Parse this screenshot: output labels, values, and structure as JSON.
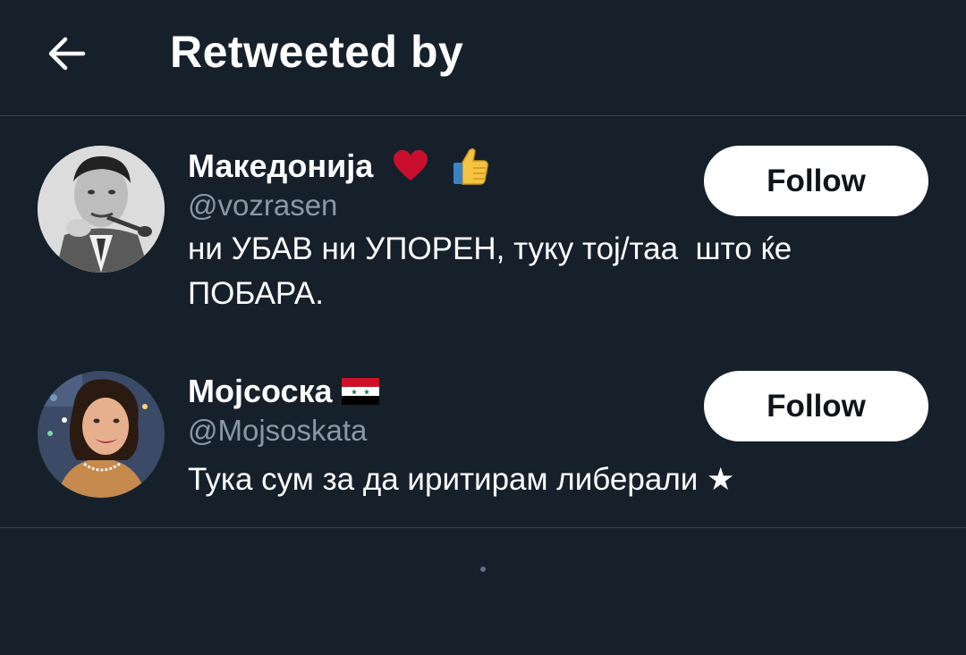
{
  "header": {
    "title": "Retweeted by",
    "back_icon": "arrow-left-icon"
  },
  "users": [
    {
      "display_name": "Македонија",
      "emojis": [
        "heart-icon",
        "thumbs-up-icon"
      ],
      "handle": "@vozrasen",
      "bio_line1": "ни УБАВ ни УПОРЕН, туку тој/таа  што ќе",
      "bio_line2": "ПОБАРА.",
      "follow_label": "Follow"
    },
    {
      "display_name": "Мојсоска",
      "emojis": [
        "syria-flag-icon"
      ],
      "handle": "@Mojsoskata",
      "bio_line1": "Тука сум за да иритирам либерали ★",
      "follow_label": "Follow"
    }
  ],
  "colors": {
    "background": "#15202b",
    "divider": "#38444d",
    "secondary_text": "#8899a6",
    "button_bg": "#ffffff",
    "button_text": "#0f1419"
  }
}
